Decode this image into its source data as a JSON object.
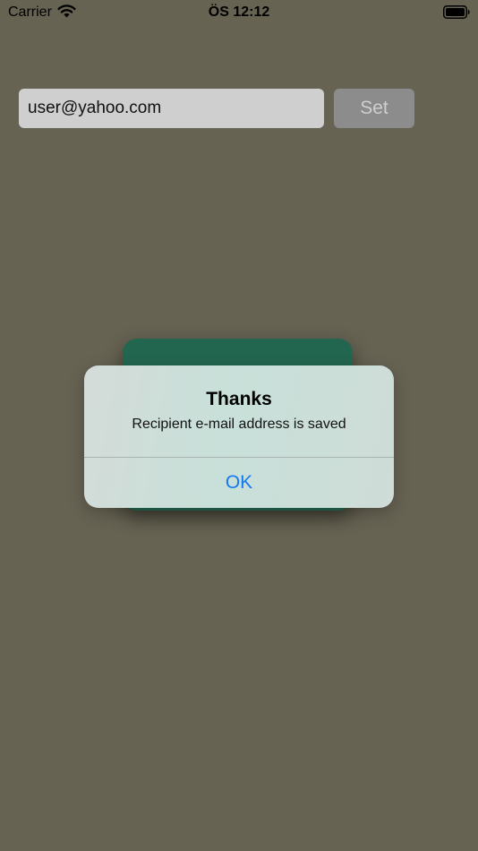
{
  "status_bar": {
    "carrier": "Carrier",
    "time": "ÖS 12:12",
    "icons": [
      "wifi-icon",
      "battery-icon"
    ]
  },
  "email_form": {
    "email_value": "user@yahoo.com",
    "set_label": "Set"
  },
  "alert": {
    "title": "Thanks",
    "message": "Recipient e-mail address is saved",
    "ok_label": "OK"
  },
  "colors": {
    "background": "#676353",
    "card": "#236650",
    "alert_action": "#1479f0",
    "field": "#cfcfcf",
    "button": "#8c8c8c"
  }
}
